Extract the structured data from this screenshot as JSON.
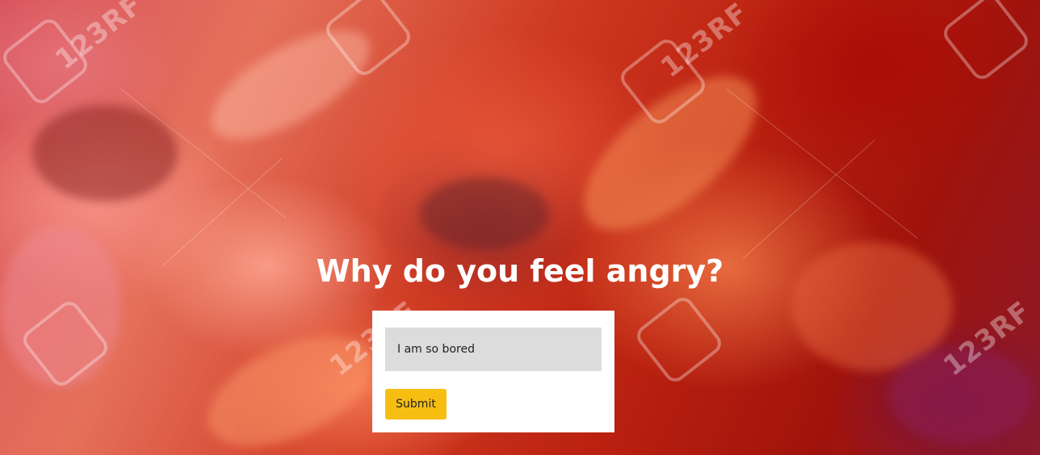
{
  "page": {
    "heading": "Why do you feel angry?",
    "background_description_colors": [
      "#d9555e",
      "#cf3a22",
      "#a0130c",
      "#8c1a2a"
    ]
  },
  "form": {
    "input_value": "I am so bored",
    "submit_label": "Submit",
    "submit_color": "#f7be12"
  },
  "watermark": {
    "text": "123RF"
  }
}
